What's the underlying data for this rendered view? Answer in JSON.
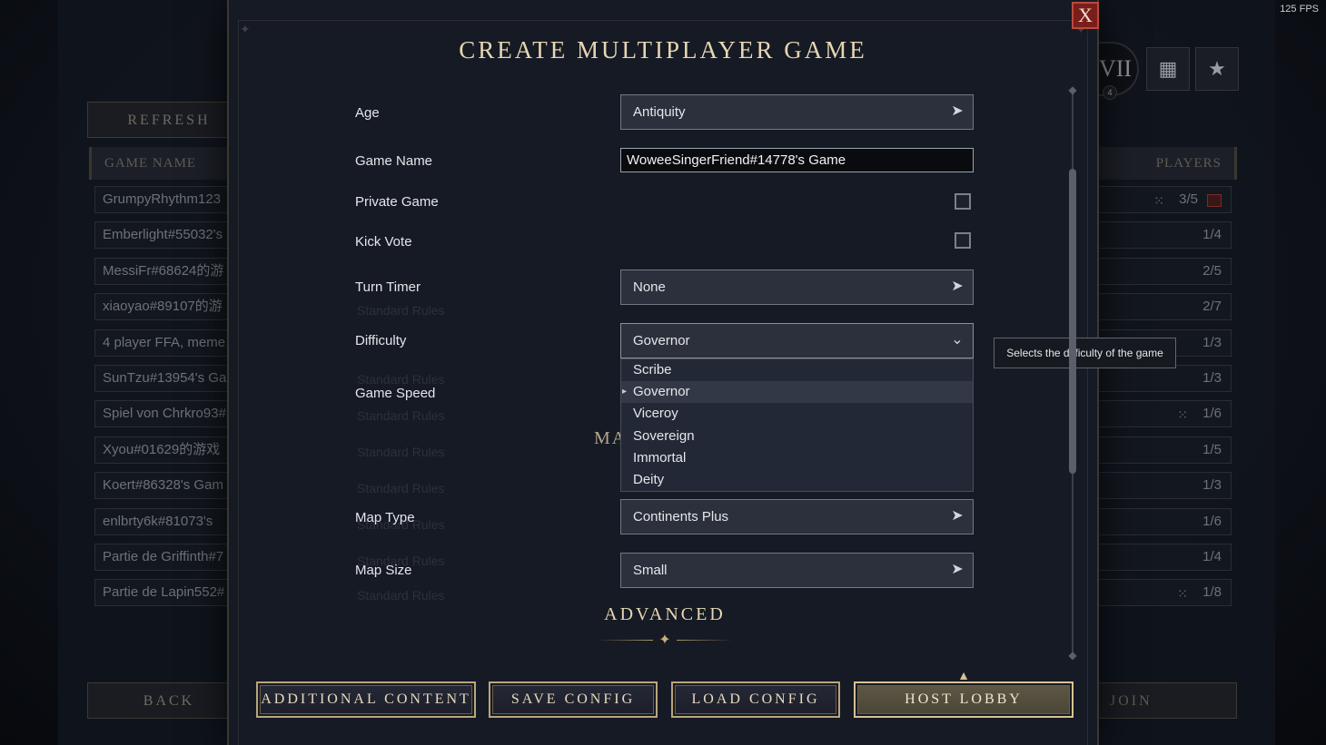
{
  "fps": "125 FPS",
  "lobby": {
    "refresh_label": "REFRESH",
    "col_game_name": "GAME NAME",
    "col_players": "PLAYERS",
    "era_numeral": "VII",
    "era_badge": "4",
    "back_label": "BACK",
    "join_label": "JOIN",
    "rows": [
      {
        "name": "GrumpyRhythm123",
        "players": "3/5",
        "dice": true,
        "flag": true
      },
      {
        "name": "Emberlight#55032's",
        "players": "1/4",
        "dice": false,
        "flag": false
      },
      {
        "name": "MessiFr#68624的游",
        "players": "2/5",
        "dice": false,
        "flag": false
      },
      {
        "name": "xiaoyao#89107的游",
        "players": "2/7",
        "dice": false,
        "flag": false
      },
      {
        "name": "4 player FFA, meme",
        "players": "1/3",
        "dice": false,
        "flag": false
      },
      {
        "name": "SunTzu#13954's Ga",
        "players": "1/3",
        "dice": false,
        "flag": false
      },
      {
        "name": "Spiel von Chrkro93#",
        "players": "1/6",
        "dice": true,
        "flag": false
      },
      {
        "name": "Xyou#01629的游戏",
        "players": "1/5",
        "dice": false,
        "flag": false
      },
      {
        "name": "Koert#86328's Gam",
        "players": "1/3",
        "dice": false,
        "flag": false
      },
      {
        "name": "enlbrty6k#81073's",
        "players": "1/6",
        "dice": false,
        "flag": false
      },
      {
        "name": "Partie de Griffinth#7",
        "players": "1/4",
        "dice": false,
        "flag": false
      },
      {
        "name": "Partie de Lapin552#",
        "players": "1/8",
        "dice": true,
        "flag": false
      }
    ]
  },
  "modal": {
    "title": "CREATE MULTIPLAYER GAME",
    "close_label": "X",
    "fields": {
      "age": {
        "label": "Age",
        "value": "Antiquity"
      },
      "game_name": {
        "label": "Game Name",
        "value": "WoweeSingerFriend#14778's Game"
      },
      "private_game": {
        "label": "Private Game",
        "checked": false
      },
      "kick_vote": {
        "label": "Kick Vote",
        "checked": false
      },
      "turn_timer": {
        "label": "Turn Timer",
        "value": "None"
      },
      "difficulty": {
        "label": "Difficulty",
        "value": "Governor"
      },
      "game_speed": {
        "label": "Game Speed"
      },
      "map_type": {
        "label": "Map Type",
        "value": "Continents Plus"
      },
      "map_size": {
        "label": "Map Size",
        "value": "Small"
      }
    },
    "difficulty_options": [
      "Scribe",
      "Governor",
      "Viceroy",
      "Sovereign",
      "Immortal",
      "Deity"
    ],
    "difficulty_selected_index": 1,
    "tooltip": "Selects the difficulty of the game",
    "partial_section_title": "MA",
    "advanced_title": "ADVANCED",
    "ghost_text": "Standard Rules",
    "buttons": {
      "additional_content": "ADDITIONAL CONTENT",
      "save_config": "SAVE CONFIG",
      "load_config": "LOAD CONFIG",
      "host_lobby": "HOST LOBBY"
    }
  },
  "colors": {
    "accent_gold": "#e6d6b3",
    "close_red": "#7a1e1c",
    "panel_bg": "#161a24"
  }
}
